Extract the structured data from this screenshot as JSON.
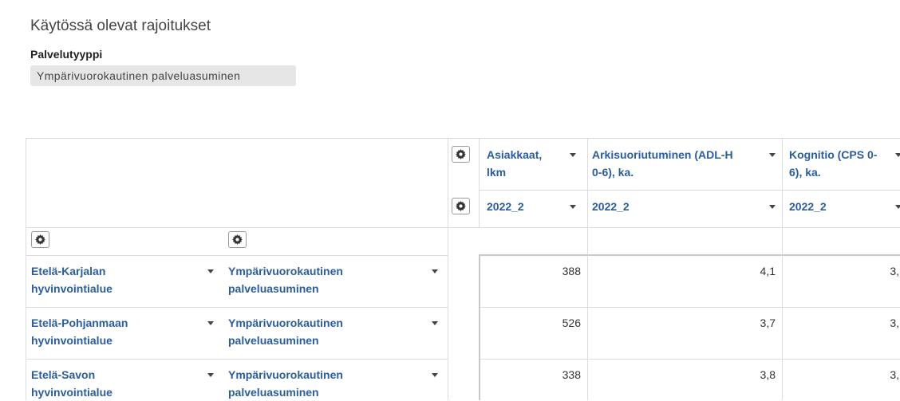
{
  "page": {
    "title": "Käytössä olevat rajoitukset",
    "filter": {
      "label": "Palvelutyyppi",
      "value": "Ympärivuorokautinen palveluasuminen"
    }
  },
  "icons": {
    "settings": "gear-icon",
    "dropdown": "caret-down-icon"
  },
  "table": {
    "columns": [
      {
        "line1": "Asiakkaat,",
        "line2": "lkm",
        "period": "2022_2"
      },
      {
        "line1": "Arkisuoriutuminen (ADL-H",
        "line2": "0-6), ka.",
        "period": "2022_2"
      },
      {
        "line1": "Kognitio (CPS 0-",
        "line2": "6), ka.",
        "period": "2022_2"
      }
    ],
    "rows": [
      {
        "region1": "Etelä-Karjalan",
        "region2": "hyvinvointialue",
        "service1": "Ympärivuorokautinen",
        "service2": "palveluasuminen",
        "values": [
          "388",
          "4,1",
          "3,"
        ]
      },
      {
        "region1": "Etelä-Pohjanmaan",
        "region2": "hyvinvointialue",
        "service1": "Ympärivuorokautinen",
        "service2": "palveluasuminen",
        "values": [
          "526",
          "3,7",
          "3,"
        ]
      },
      {
        "region1": "Etelä-Savon",
        "region2": "hyvinvointialue",
        "service1": "Ympärivuorokautinen",
        "service2": "palveluasuminen",
        "values": [
          "338",
          "3,8",
          "3,"
        ]
      }
    ]
  },
  "colors": {
    "link": "#2a5d9f",
    "chip_bg": "#e6e6e6",
    "border": "#dcdcdc"
  }
}
